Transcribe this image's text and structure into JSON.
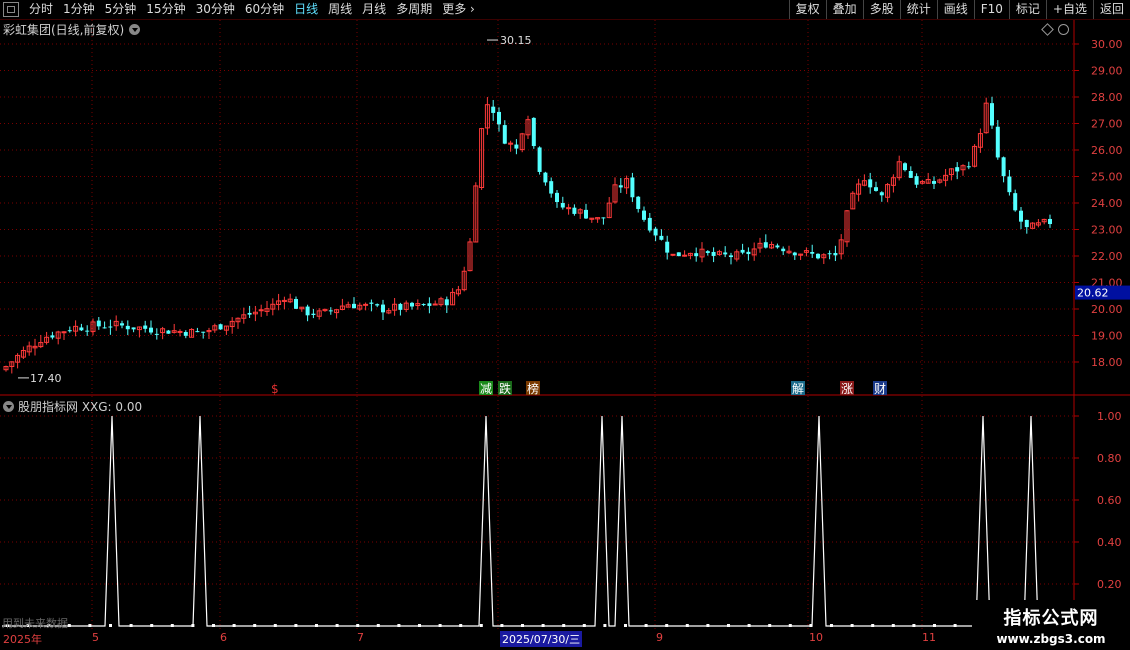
{
  "toolbar": {
    "periods": [
      {
        "label": "分时"
      },
      {
        "label": "1分钟"
      },
      {
        "label": "5分钟"
      },
      {
        "label": "15分钟"
      },
      {
        "label": "30分钟"
      },
      {
        "label": "60分钟"
      },
      {
        "label": "日线"
      },
      {
        "label": "周线"
      },
      {
        "label": "月线"
      },
      {
        "label": "多周期"
      },
      {
        "label": "更多"
      }
    ],
    "active_period": "日线",
    "more_glyph": "›",
    "tools": [
      {
        "label": "复权"
      },
      {
        "label": "叠加"
      },
      {
        "label": "多股"
      },
      {
        "label": "统计"
      },
      {
        "label": "画线"
      },
      {
        "label": "F10"
      },
      {
        "label": "标记"
      },
      {
        "label": "+自选"
      },
      {
        "label": "返回"
      }
    ]
  },
  "main_chart": {
    "title": "彩虹集团(日线,前复权)",
    "high_label": "30.15",
    "low_label": "17.40",
    "current_price": "20.62",
    "price_ticks": [
      "30.00",
      "29.00",
      "28.00",
      "27.00",
      "26.00",
      "25.00",
      "24.00",
      "23.00",
      "22.00",
      "21.00",
      "20.00",
      "19.00",
      "18.00"
    ]
  },
  "markers": [
    {
      "text": "$",
      "color": "#e03030"
    },
    {
      "text": "减",
      "color": "#ffffff",
      "bg": "#1a8a1a"
    },
    {
      "text": "跌",
      "color": "#ffffff",
      "bg": "#1a6a1a"
    },
    {
      "text": "榜",
      "color": "#ffffff",
      "bg": "#7a3a00"
    },
    {
      "text": "解",
      "color": "#ffffff",
      "bg": "#1a6a8a"
    },
    {
      "text": "涨",
      "color": "#ffffff",
      "bg": "#8a1a1a"
    },
    {
      "text": "财",
      "color": "#ffffff",
      "bg": "#1a3a8a"
    }
  ],
  "sub_chart": {
    "title": "股朋指标网 XXG: 0.00",
    "ticks": [
      "1.00",
      "0.80",
      "0.60",
      "0.40",
      "0.20"
    ]
  },
  "time_axis": {
    "labels": [
      "2025年",
      "5",
      "6",
      "7",
      "2025/07/30/三",
      "9",
      "10",
      "11"
    ]
  },
  "ghost_text": "用到未来数据",
  "watermark": {
    "line1": "指标公式网",
    "line2": "www.zbgs3.com"
  },
  "colors": {
    "up": "#ff3a3a",
    "down": "#54ffff",
    "grid": "#7a0000",
    "axis": "#b00000"
  }
}
